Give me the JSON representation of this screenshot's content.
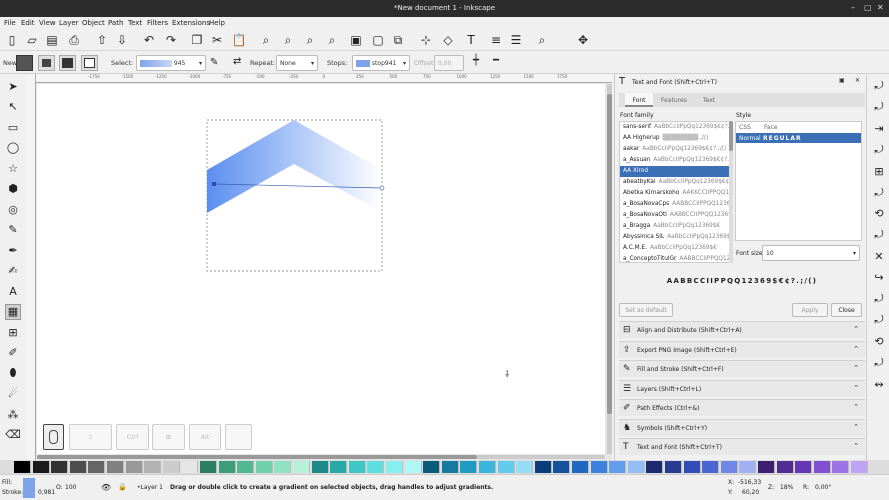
{
  "window": {
    "title": "*New document 1 - Inkscape",
    "min": "–",
    "max": "▢",
    "close": "✕"
  },
  "menu": [
    "File",
    "Edit",
    "View",
    "Layer",
    "Object",
    "Path",
    "Text",
    "Filters",
    "Extensions",
    "Help"
  ],
  "commands": [
    "new-doc",
    "open",
    "save",
    "print",
    "import",
    "export",
    "undo",
    "redo",
    "copy",
    "cut",
    "paste",
    "zoom-selection",
    "zoom-drawing",
    "zoom-page",
    "zoom-width",
    "group",
    "ungroup",
    "duplicate",
    "node-editor",
    "xml-editor",
    "text-font",
    "align",
    "layers",
    "find",
    "transform"
  ],
  "gradient_bar": {
    "new_label": "New:",
    "select_label": "Select:",
    "gradient_value": "945",
    "repeat_label": "Repeat:",
    "repeat_value": "None",
    "stops_label": "Stops:",
    "stop_value": "stop941",
    "offset_label": "Offset:",
    "offset_value": "0,00"
  },
  "ruler_marks": [
    "-1750",
    "-1500",
    "-1250",
    "-1000",
    "-750",
    "-500",
    "-250",
    "0",
    "250",
    "500",
    "750",
    "1000",
    "1250",
    "1500",
    "1750"
  ],
  "tools": [
    "selector",
    "node",
    "rect",
    "circle",
    "star",
    "3d-box",
    "spiral",
    "pencil",
    "pen",
    "calligraphy",
    "text",
    "gradient",
    "mesh",
    "dropper",
    "paint-bucket",
    "tweak",
    "spray",
    "eraser"
  ],
  "snap_bar": [
    "Ctrl",
    "Alt"
  ],
  "text_font_panel": {
    "header": "Text and Font (Shift+Ctrl+T)",
    "tabs": [
      "Font",
      "Features",
      "Text"
    ],
    "family_label": "Font family",
    "style_label": "Style",
    "style_cols": [
      "CSS",
      "Face"
    ],
    "style_row": {
      "css": "Normal",
      "face": "REGULAR"
    },
    "fonts": [
      {
        "name": "sans-serif",
        "preview": "AaBbCcIiPpQq12369$€¢?.;/()"
      },
      {
        "name": "AA Higherup",
        "preview": "▒▒▒▒▒▒▒▒.;/()"
      },
      {
        "name": "aakar",
        "preview": "AaBbCcIiPpQq12369$€¢?.;/()"
      },
      {
        "name": "a_Assuan",
        "preview": "AaBbCcIiPpQq12369$€¢?.;/()"
      },
      {
        "name": "AA Xirod",
        "preview": ""
      },
      {
        "name": "abeatbyKai",
        "preview": "AaBbCcIiPpQq12369$€¢?.;/()"
      },
      {
        "name": "Abetka Kirnarskoho",
        "preview": "AAKKCCIIPPQQ12369"
      },
      {
        "name": "a_BosaNovaCps",
        "preview": "AABBCCIIPPQQ12369$€"
      },
      {
        "name": "a_BosaNovaOtl",
        "preview": "AABBCCIIPPQQ12369$€"
      },
      {
        "name": "a_Bragga",
        "preview": "AaBbCcIiPpQq12369$€"
      },
      {
        "name": "Abyssinica SIL",
        "preview": "AaBbCcIiPpQq12369$€"
      },
      {
        "name": "A.C.M.E.",
        "preview": "AaBbCcIiPpQq12369$€"
      },
      {
        "name": "a_ConceptoTitulGr",
        "preview": "AABBCCIIPPQQ12369$€"
      }
    ],
    "selected_index": 4,
    "font_size_label": "Font size",
    "font_size": "10",
    "preview_text": "AABBCCIIPPQQ12369$€¢?.;/()",
    "set_default": "Set as default",
    "apply": "Apply",
    "close": "Close"
  },
  "dock_rows": [
    {
      "label": "Align and Distribute (Shift+Ctrl+A)",
      "icon": "align-icon"
    },
    {
      "label": "Export PNG Image (Shift+Ctrl+E)",
      "icon": "export-icon"
    },
    {
      "label": "Fill and Stroke (Shift+Ctrl+F)",
      "icon": "fill-stroke-icon"
    },
    {
      "label": "Layers (Shift+Ctrl+L)",
      "icon": "layers-icon"
    },
    {
      "label": "Path Effects (Ctrl+&)",
      "icon": "path-effects-icon"
    },
    {
      "label": "Symbols (Shift+Ctrl+Y)",
      "icon": "symbols-icon"
    },
    {
      "label": "Text and Font (Shift+Ctrl+T)",
      "icon": "text-icon"
    }
  ],
  "palette": [
    "#000000",
    "#1a1a1a",
    "#333333",
    "#4d4d4d",
    "#666666",
    "#808080",
    "#999999",
    "#b3b3b3",
    "#cccccc",
    "#e6e6e6",
    "#2a7f62",
    "#3c9d7a",
    "#52b893",
    "#6fd0ab",
    "#8fe3c4",
    "#b5f1db",
    "#1d8a8a",
    "#29a8a8",
    "#3fc6c6",
    "#5edfdf",
    "#86efef",
    "#b0f7f7",
    "#0a5a7a",
    "#147a9e",
    "#1f9ac2",
    "#3bb5dc",
    "#63cbee",
    "#93ddf6",
    "#0b3d7a",
    "#14529e",
    "#1f68c2",
    "#3b83dc",
    "#639eee",
    "#93bff6",
    "#1b2a6e",
    "#263b91",
    "#324db5",
    "#4a66d1",
    "#6f87e6",
    "#9fb0f3",
    "#3c1f6e",
    "#512b91",
    "#6637b5",
    "#8050d1",
    "#9d73e6",
    "#c0a3f3"
  ],
  "status": {
    "fill_label": "Fill:",
    "stroke_label": "Stroke:",
    "stroke_value": "0,981",
    "opacity_label": "O:",
    "opacity_value": "100",
    "layer": "•Layer 1",
    "message": "Drag or double click to create a gradient on selected objects, drag handles to adjust gradients.",
    "x_label": "X:",
    "x_value": "-516,33",
    "y_label": "Y:",
    "y_value": "60,20",
    "zoom_label": "Z:",
    "zoom_value": "18%",
    "rot_label": "R:",
    "rot_value": "0,00°"
  },
  "colors": {
    "accent": "#3b6fb6",
    "gradient": "#5b8ff0"
  }
}
